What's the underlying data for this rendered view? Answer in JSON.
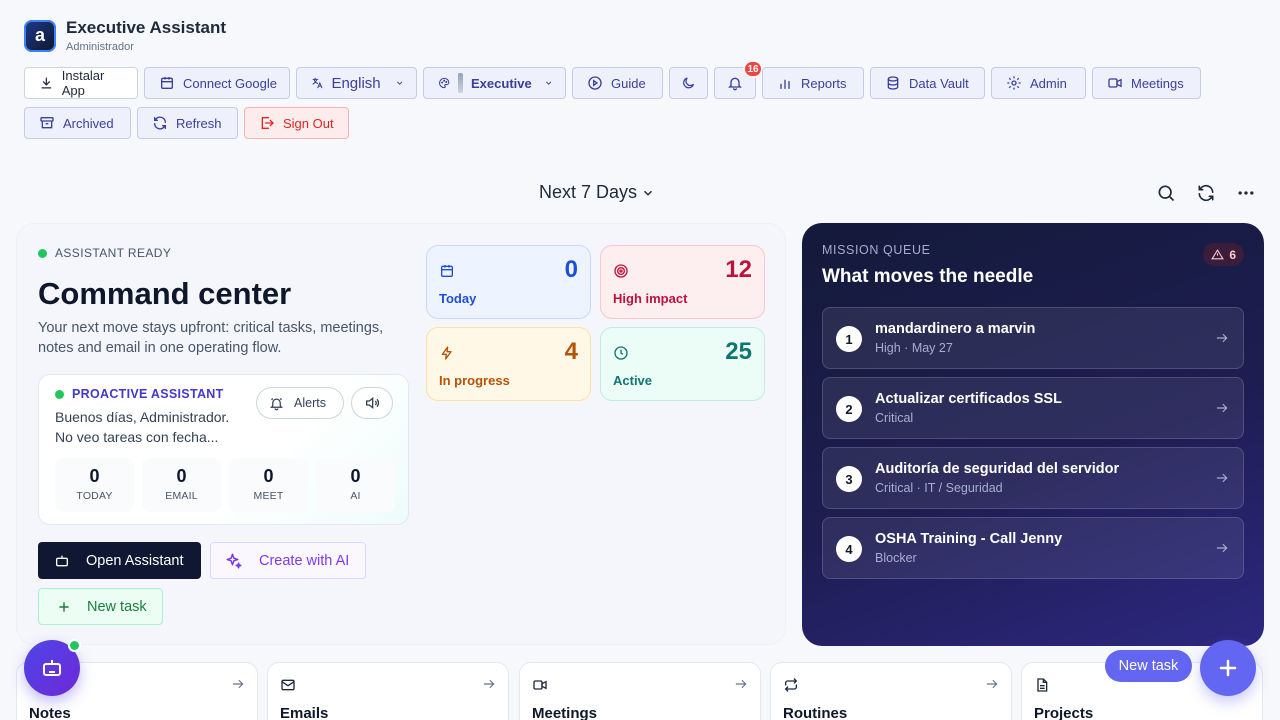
{
  "app": {
    "title": "Executive Assistant",
    "subtitle": "Administrador",
    "logo_letter": "a"
  },
  "toolbar": {
    "install": "Instalar App",
    "connect_google": "Connect Google",
    "language": "English",
    "theme": "Executive",
    "guide": "Guide",
    "notifications_count": "16",
    "reports": "Reports",
    "data_vault": "Data Vault",
    "admin": "Admin",
    "meetings": "Meetings",
    "archived": "Archived",
    "refresh": "Refresh",
    "sign_out": "Sign Out"
  },
  "range": {
    "label": "Next 7 Days"
  },
  "command": {
    "status": "ASSISTANT READY",
    "title": "Command center",
    "description": "Your next move stays upfront: critical tasks, meetings, notes and email in one operating flow.",
    "proactive": {
      "label": "PROACTIVE ASSISTANT",
      "message_line1": "Buenos días, Administrador.",
      "message_line2": "No veo tareas con fecha...",
      "alerts_label": "Alerts",
      "stats": [
        {
          "value": "0",
          "label": "TODAY"
        },
        {
          "value": "0",
          "label": "EMAIL"
        },
        {
          "value": "0",
          "label": "MEET"
        },
        {
          "value": "0",
          "label": "AI"
        }
      ]
    },
    "open_assistant": "Open Assistant",
    "create_ai": "Create with AI",
    "new_task": "New task"
  },
  "kpis": {
    "today": {
      "value": "0",
      "label": "Today"
    },
    "high_impact": {
      "value": "12",
      "label": "High impact"
    },
    "in_progress": {
      "value": "4",
      "label": "In progress"
    },
    "active": {
      "value": "25",
      "label": "Active"
    }
  },
  "mission": {
    "kicker": "MISSION QUEUE",
    "title": "What moves the needle",
    "alert_count": "6",
    "items": [
      {
        "num": "1",
        "title": "mandardinero a marvin",
        "meta": "High · May 27"
      },
      {
        "num": "2",
        "title": "Actualizar certificados SSL",
        "meta": "Critical"
      },
      {
        "num": "3",
        "title": "Auditoría de seguridad del servidor",
        "meta": "Critical · IT / Seguridad"
      },
      {
        "num": "4",
        "title": "OSHA Training - Call Jenny",
        "meta": "Blocker"
      }
    ]
  },
  "modules": {
    "notes": "Notes",
    "emails": "Emails",
    "meetings": "Meetings",
    "routines": "Routines",
    "projects": "Projects"
  },
  "fab": {
    "new_task": "New task"
  },
  "colors": {
    "accent": "#6366f1",
    "mission_bg": "#1e1d52",
    "danger": "#dc2626"
  }
}
